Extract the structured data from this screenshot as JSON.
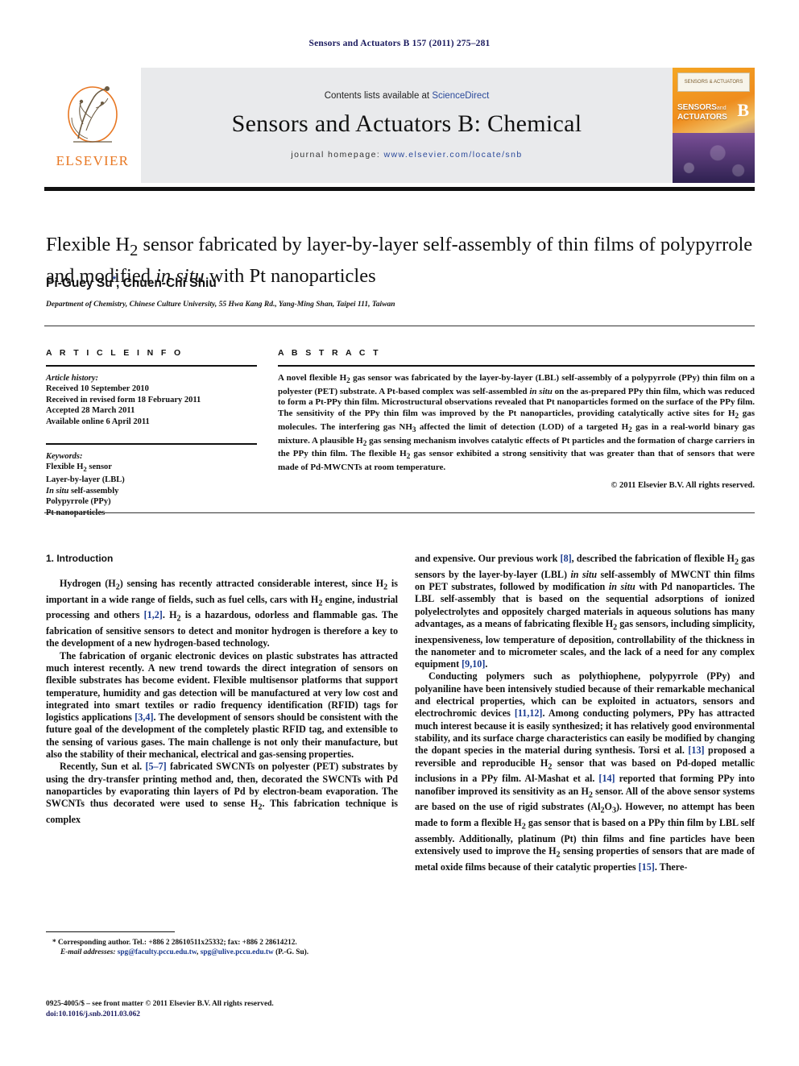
{
  "running_head": "Sensors and Actuators B 157 (2011) 275–281",
  "journal_header": {
    "contents_prefix": "Contents lists available at ",
    "contents_link": "ScienceDirect",
    "journal_title": "Sensors and Actuators B: Chemical",
    "homepage_label": "journal homepage:",
    "homepage_url": "www.elsevier.com/locate/snb",
    "publisher_name": "ELSEVIER",
    "cover_badge_top": "SENSORS & ACTUATORS",
    "cover_title_line1": "SENSORS",
    "cover_title_and": "and",
    "cover_title_line2": "ACTUATORS",
    "cover_volume_letter": "B"
  },
  "article": {
    "title_part1": "Flexible H",
    "title_sub1": "2",
    "title_part2": " sensor fabricated by layer-by-layer self-assembly of thin films of polypyrrole and modified ",
    "title_italic": "in situ",
    "title_part3": " with Pt nanoparticles",
    "authors": "Pi-Guey Su",
    "author_star": "*",
    "authors_rest": ", Chuen-Chi Shiu",
    "affiliation": "Department of Chemistry, Chinese Culture University, 55 Hwa Kang Rd., Yang-Ming Shan, Taipei 111, Taiwan"
  },
  "article_info": {
    "heading": "A R T I C L E   I N F O",
    "history_label": "Article history:",
    "history": [
      "Received 10 September 2010",
      "Received in revised form 18 February 2011",
      "Accepted 28 March 2011",
      "Available online 6 April 2011"
    ],
    "keywords_label": "Keywords:",
    "keywords": [
      "Flexible H2 sensor",
      "Layer-by-layer (LBL)",
      "In situ self-assembly",
      "Polypyrrole (PPy)",
      "Pt nanoparticles"
    ]
  },
  "abstract": {
    "heading": "A B S T R A C T",
    "text": "A novel flexible H2 gas sensor was fabricated by the layer-by-layer (LBL) self-assembly of a polypyrrole (PPy) thin film on a polyester (PET) substrate. A Pt-based complex was self-assembled in situ on the as-prepared PPy thin film, which was reduced to form a Pt-PPy thin film. Microstructural observations revealed that Pt nanoparticles formed on the surface of the PPy film. The sensitivity of the PPy thin film was improved by the Pt nanoparticles, providing catalytically active sites for H2 gas molecules. The interfering gas NH3 affected the limit of detection (LOD) of a targeted H2 gas in a real-world binary gas mixture. A plausible H2 gas sensing mechanism involves catalytic effects of Pt particles and the formation of charge carriers in the PPy thin film. The flexible H2 gas sensor exhibited a strong sensitivity that was greater than that of sensors that were made of Pd-MWCNTs at room temperature.",
    "copyright": "© 2011 Elsevier B.V. All rights reserved."
  },
  "introduction": {
    "heading": "1.  Introduction",
    "paragraph_1": "Hydrogen (H2) sensing has recently attracted considerable interest, since H2 is important in a wide range of fields, such as fuel cells, cars with H2 engine, industrial processing and others [1,2]. H2 is a hazardous, odorless and flammable gas. The fabrication of sensitive sensors to detect and monitor hydrogen is therefore a key to the development of a new hydrogen-based technology.",
    "paragraph_2": "The fabrication of organic electronic devices on plastic substrates has attracted much interest recently. A new trend towards the direct integration of sensors on flexible substrates has become evident. Flexible multisensor platforms that support temperature, humidity and gas detection will be manufactured at very low cost and integrated into smart textiles or radio frequency identification (RFID) tags for logistics applications [3,4]. The development of sensors should be consistent with the future goal of the development of the completely plastic RFID tag, and extensible to the sensing of various gases. The main challenge is not only their manufacture, but also the stability of their mechanical, electrical and gas-sensing properties.",
    "paragraph_3": "Recently, Sun et al. [5–7] fabricated SWCNTs on polyester (PET) substrates by using the dry-transfer printing method and, then, decorated the SWCNTs with Pd nanoparticles by evaporating thin layers of Pd by electron-beam evaporation. The SWCNTs thus decorated were used to sense H2. This fabrication technique is complex and expensive. Our previous work [8], described the fabrication of flexible H2 gas sensors by the layer-by-layer (LBL) in situ self-assembly of MWCNT thin films on PET substrates, followed by modification in situ with Pd nanoparticles. The LBL self-assembly that is based on the sequential adsorptions of ionized polyelectrolytes and oppositely charged materials in aqueous solutions has many advantages, as a means of fabricating flexible H2 gas sensors, including simplicity, inexpensiveness, low temperature of deposition, controllability of the thickness in the nanometer and to micrometer scales, and the lack of a need for any complex equipment [9,10].",
    "paragraph_4": "Conducting polymers such as polythiophene, polypyrrole (PPy) and polyaniline have been intensively studied because of their remarkable mechanical and electrical properties, which can be exploited in actuators, sensors and electrochromic devices [11,12]. Among conducting polymers, PPy has attracted much interest because it is easily synthesized; it has relatively good environmental stability, and its surface charge characteristics can easily be modified by changing the dopant species in the material during synthesis. Torsi et al. [13] proposed a reversible and reproducible H2 sensor that was based on Pd-doped metallic inclusions in a PPy film. Al-Mashat et al. [14] reported that forming PPy into nanofiber improved its sensitivity as an H2 sensor. All of the above sensor systems are based on the use of rigid substrates (Al2O3). However, no attempt has been made to form a flexible H2 gas sensor that is based on a PPy thin film by LBL self assembly. Additionally, platinum (Pt) thin films and fine particles have been extensively used to improve the H2 sensing properties of sensors that are made of metal oxide films because of their catalytic properties [15]. There-"
  },
  "footnotes": {
    "corresponding": "* Corresponding author. Tel.: +886 2 28610511x25332; fax: +886 2 28614212.",
    "email_label": "E-mail addresses:",
    "email_1": "spg@faculty.pccu.edu.tw",
    "email_2": "spg@ulive.pccu.edu.tw",
    "email_suffix": "(P.-G. Su)."
  },
  "footer": {
    "issn_line": "0925-4005/$ – see front matter © 2011 Elsevier B.V. All rights reserved.",
    "doi_line": "doi:10.1016/j.snb.2011.03.062"
  },
  "colors": {
    "link_blue": "#2b4a9b",
    "ref_blue": "#1a3a8f",
    "elsevier_orange": "#E87722",
    "band_gray": "#e9eaec"
  }
}
